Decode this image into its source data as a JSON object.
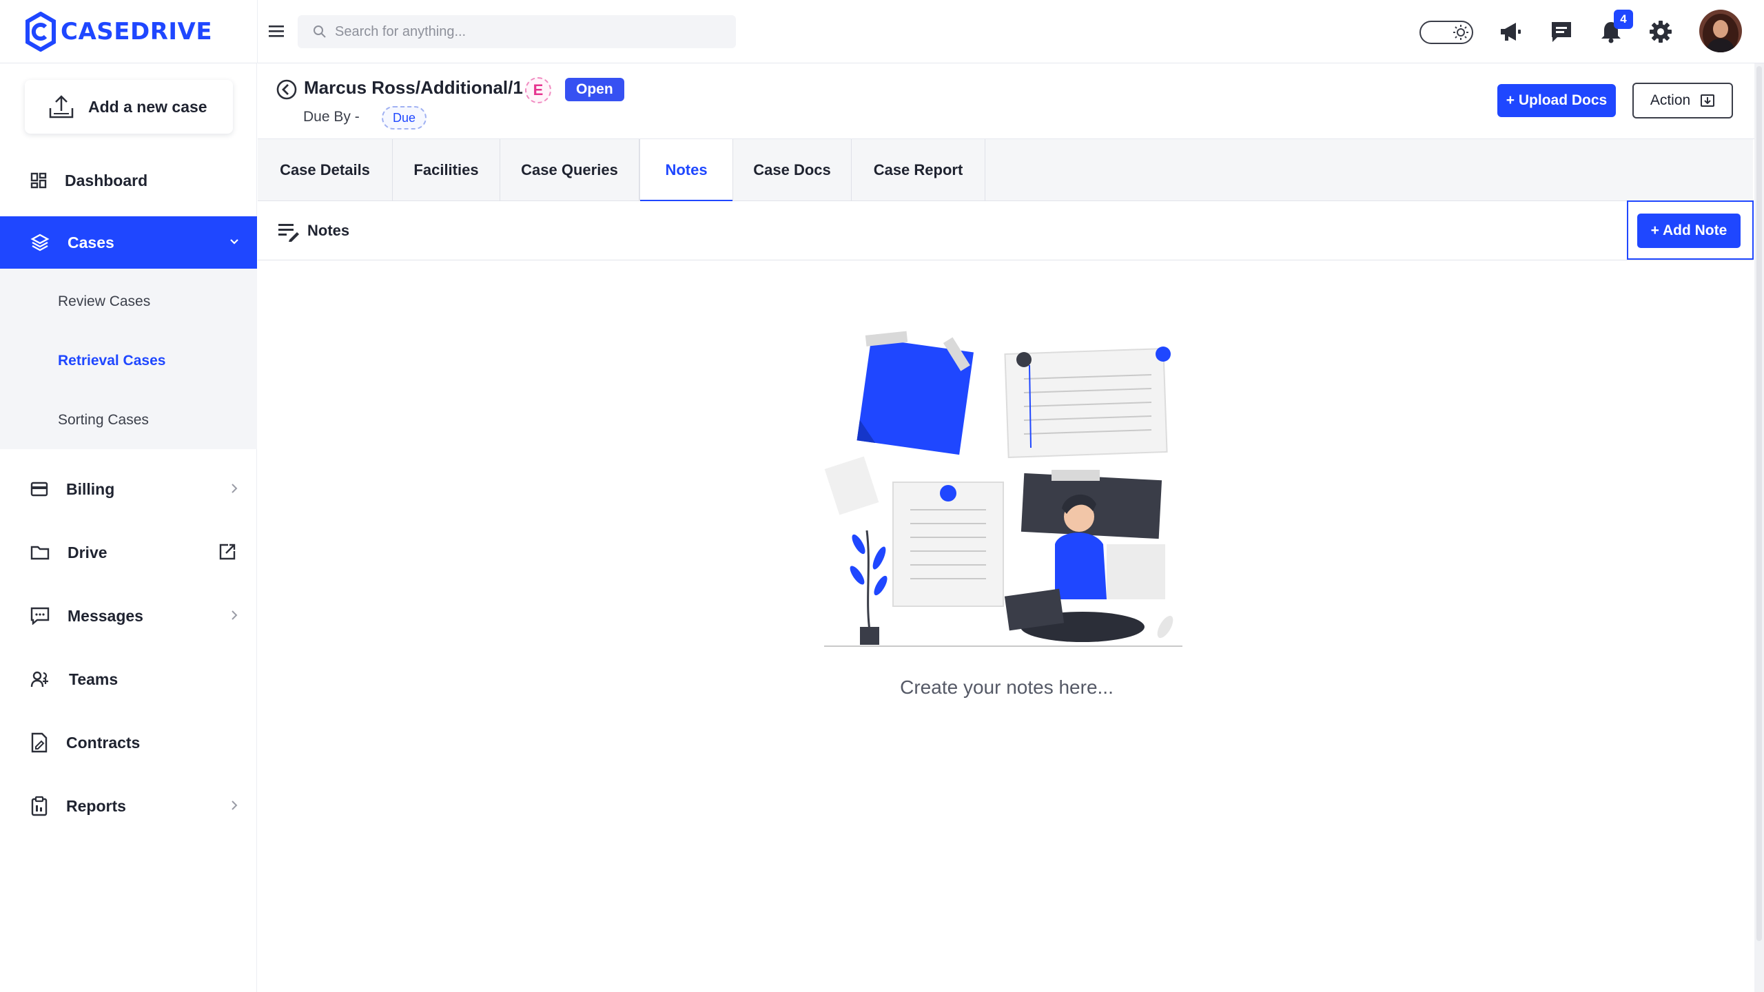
{
  "app": {
    "brand": "CASEDRIVE",
    "accent_color": "#1f47ff"
  },
  "header": {
    "search_placeholder": "Search for anything...",
    "notifications_count": "4",
    "icons": [
      "menu-icon",
      "search-icon",
      "theme-toggle",
      "megaphone-icon",
      "chat-icon",
      "bell-icon",
      "gear-icon",
      "avatar"
    ]
  },
  "sidebar": {
    "add_case_label": "Add a new case",
    "items": [
      {
        "label": "Dashboard",
        "icon": "dashboard-icon"
      },
      {
        "label": "Cases",
        "icon": "layers-icon",
        "active": true,
        "expanded": true
      },
      {
        "label": "Billing",
        "icon": "credit-card-icon"
      },
      {
        "label": "Drive",
        "icon": "folder-icon"
      },
      {
        "label": "Messages",
        "icon": "message-icon"
      },
      {
        "label": "Teams",
        "icon": "team-icon"
      },
      {
        "label": "Contracts",
        "icon": "contract-icon"
      },
      {
        "label": "Reports",
        "icon": "clipboard-icon"
      }
    ],
    "sub_items": [
      {
        "label": "Review Cases"
      },
      {
        "label": "Retrieval Cases",
        "active": true
      },
      {
        "label": "Sorting Cases"
      }
    ]
  },
  "case": {
    "title": "Marcus Ross/Additional/1",
    "badge_letter": "E",
    "status": "Open",
    "due_by_label": "Due By -",
    "due_badge": "Due",
    "upload_label": "+ Upload Docs",
    "action_label": "Action"
  },
  "tabs": [
    {
      "label": "Case Details"
    },
    {
      "label": "Facilities"
    },
    {
      "label": "Case Queries"
    },
    {
      "label": "Notes",
      "active": true
    },
    {
      "label": "Case Docs"
    },
    {
      "label": "Case Report"
    }
  ],
  "notes": {
    "title": "Notes",
    "add_label": "+ Add Note",
    "empty_text": "Create your notes here..."
  }
}
